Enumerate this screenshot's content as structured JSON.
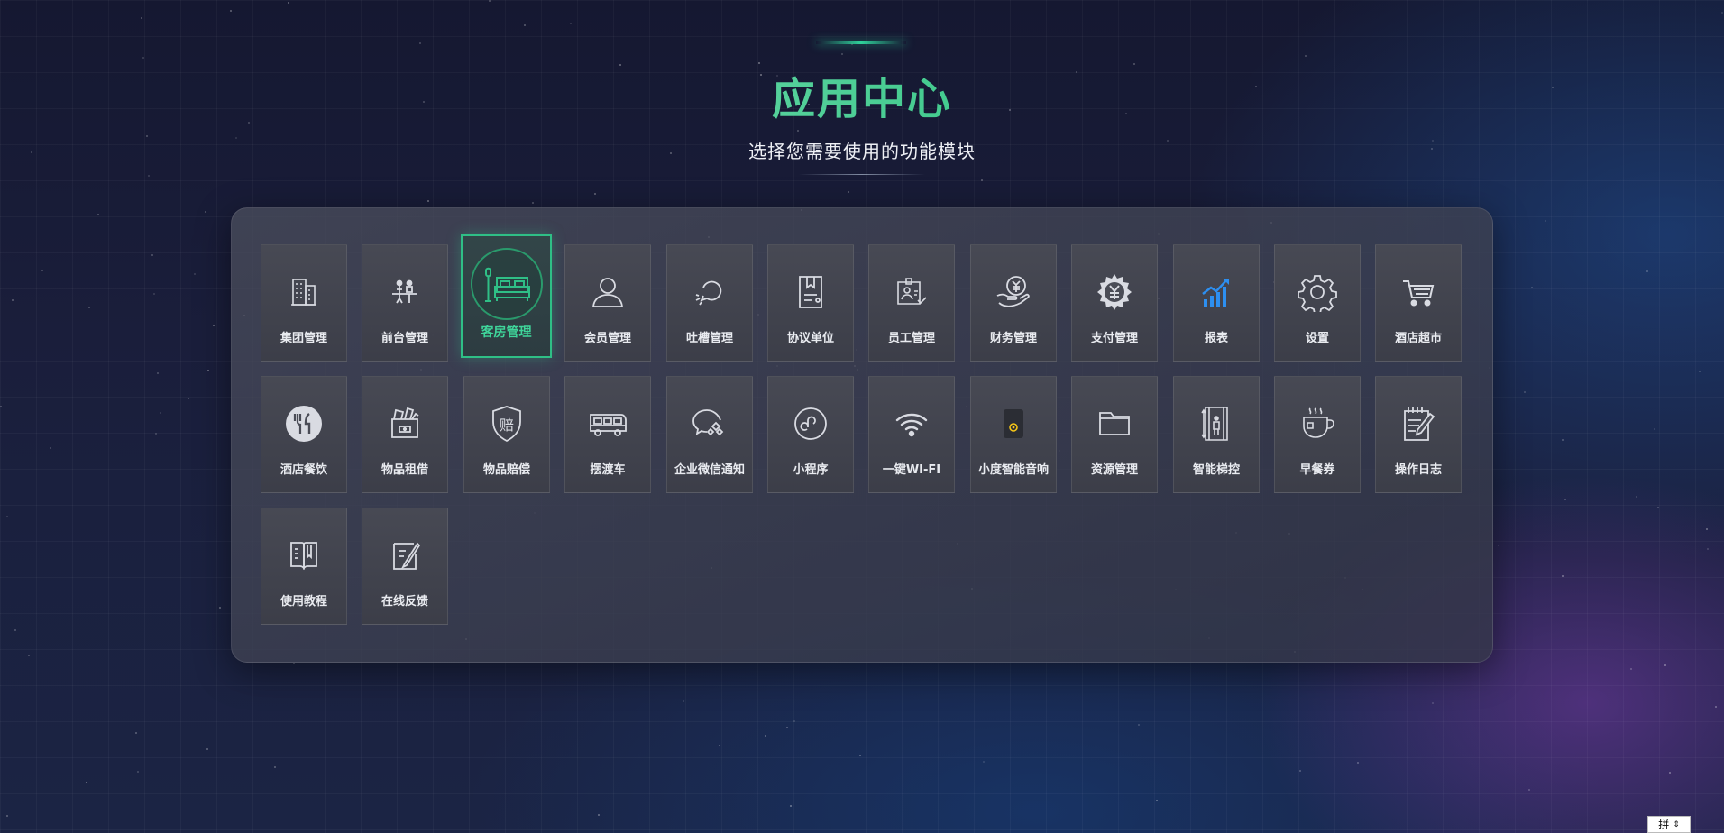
{
  "header": {
    "title": "应用中心",
    "subtitle": "选择您需要使用的功能模块"
  },
  "modules": [
    {
      "label": "集团管理",
      "icon": "building-icon"
    },
    {
      "label": "前台管理",
      "icon": "front-desk-icon"
    },
    {
      "label": "客房管理",
      "icon": "bed-icon",
      "active": true
    },
    {
      "label": "会员管理",
      "icon": "user-icon"
    },
    {
      "label": "吐槽管理",
      "icon": "comment-icon"
    },
    {
      "label": "协议单位",
      "icon": "agreement-icon"
    },
    {
      "label": "员工管理",
      "icon": "staff-icon"
    },
    {
      "label": "财务管理",
      "icon": "finance-icon"
    },
    {
      "label": "支付管理",
      "icon": "payment-gear-icon"
    },
    {
      "label": "报表",
      "icon": "report-chart-icon"
    },
    {
      "label": "设置",
      "icon": "settings-gear-icon"
    },
    {
      "label": "酒店超市",
      "icon": "shopping-cart-icon"
    },
    {
      "label": "酒店餐饮",
      "icon": "dining-icon"
    },
    {
      "label": "物品租借",
      "icon": "rental-box-icon"
    },
    {
      "label": "物品赔偿",
      "icon": "compensation-shield-icon"
    },
    {
      "label": "摆渡车",
      "icon": "shuttle-bus-icon"
    },
    {
      "label": "企业微信通知",
      "icon": "wechat-icon"
    },
    {
      "label": "小程序",
      "icon": "mini-program-icon"
    },
    {
      "label": "一键WI-FI",
      "icon": "wifi-icon"
    },
    {
      "label": "小度智能音响",
      "icon": "smart-speaker-icon"
    },
    {
      "label": "资源管理",
      "icon": "folder-icon"
    },
    {
      "label": "智能梯控",
      "icon": "elevator-icon"
    },
    {
      "label": "早餐券",
      "icon": "coffee-cup-icon"
    },
    {
      "label": "操作日志",
      "icon": "log-notepad-icon"
    },
    {
      "label": "使用教程",
      "icon": "book-icon"
    },
    {
      "label": "在线反馈",
      "icon": "feedback-edit-icon"
    }
  ],
  "ime": {
    "label": "拼"
  },
  "colors": {
    "accent": "#2fbf86",
    "report_icon": "#2d8ff0",
    "speaker_dot": "#f5c518"
  }
}
